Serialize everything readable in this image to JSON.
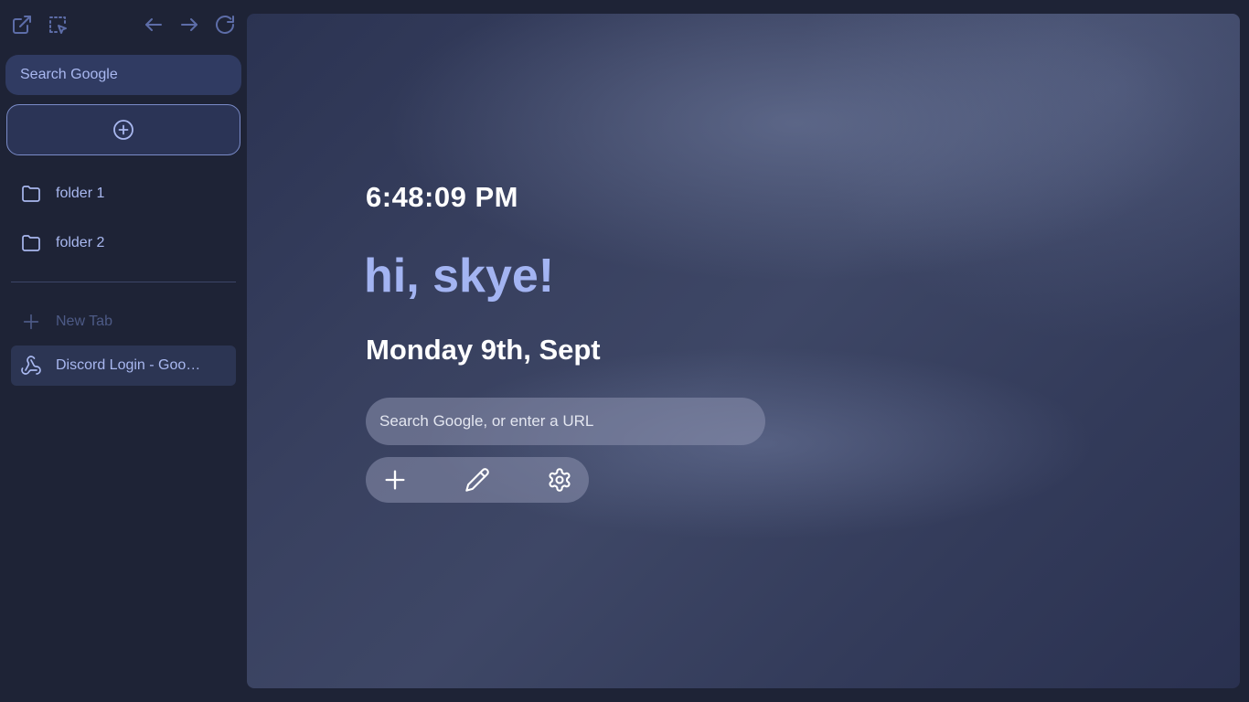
{
  "sidebar": {
    "toolbar": {
      "icons": [
        "open-external-icon",
        "select-area-icon",
        "arrow-left-icon",
        "arrow-right-icon",
        "reload-icon"
      ]
    },
    "search": {
      "placeholder": "Search Google"
    },
    "add_button": {
      "icon": "plus-circle-icon"
    },
    "folders": [
      {
        "label": "folder 1",
        "icon": "folder-icon"
      },
      {
        "label": "folder 2",
        "icon": "folder-icon"
      }
    ],
    "new_tab": {
      "label": "New Tab",
      "icon": "plus-icon"
    },
    "tabs": [
      {
        "label": "Discord Login - Google Chrome",
        "icon": "webhook-icon",
        "active": true
      }
    ]
  },
  "main": {
    "time": "6:48:09 PM",
    "greeting": "hi, skye!",
    "date": "Monday 9th, Sept",
    "search": {
      "placeholder": "Search Google, or enter a URL"
    },
    "actions": [
      "plus-icon",
      "pencil-icon",
      "gear-icon"
    ]
  },
  "colors": {
    "background": "#1e2336",
    "accent": "#a3b4f2",
    "panel": "#303b62"
  }
}
